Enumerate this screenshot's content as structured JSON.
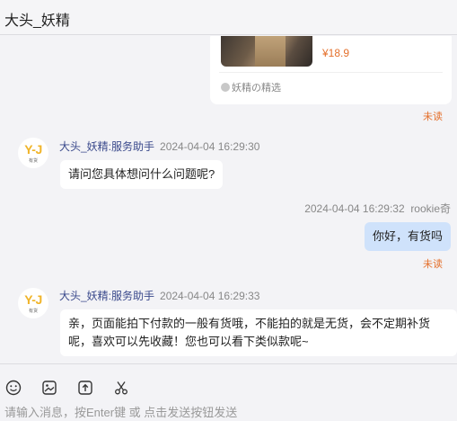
{
  "header": {
    "title": "大头_妖精"
  },
  "product": {
    "price": "¥18.9",
    "shop": "妖精の精选"
  },
  "messages": [
    {
      "unread": "未读"
    },
    {
      "sender": "大头_妖精:服务助手",
      "time": "2024-04-04 16:29:30",
      "text": "请问您具体想问什么问题呢?",
      "avatar_text": "Y-J",
      "avatar_sub": "有货"
    },
    {
      "sender": "rookie奇",
      "time": "2024-04-04 16:29:32",
      "text": "你好，有货吗",
      "unread": "未读"
    },
    {
      "sender": "大头_妖精:服务助手",
      "time": "2024-04-04 16:29:33",
      "text": "亲，页面能拍下付款的一般有货哦，不能拍的就是无货，会不定期补货呢，喜欢可以先收藏！您也可以看下类似款呢~",
      "avatar_text": "Y-J",
      "avatar_sub": "有货"
    }
  ],
  "composer": {
    "placeholder": "请输入消息，按Enter键 或 点击发送按钮发送",
    "tools": [
      "emoji-icon",
      "image-icon",
      "upload-icon",
      "scissors-icon"
    ]
  },
  "colors": {
    "accent_unread": "#e4702c",
    "bubble_mine": "#cfe2fb",
    "sender_name": "#3b4a8c",
    "logo": "#f0b429"
  }
}
